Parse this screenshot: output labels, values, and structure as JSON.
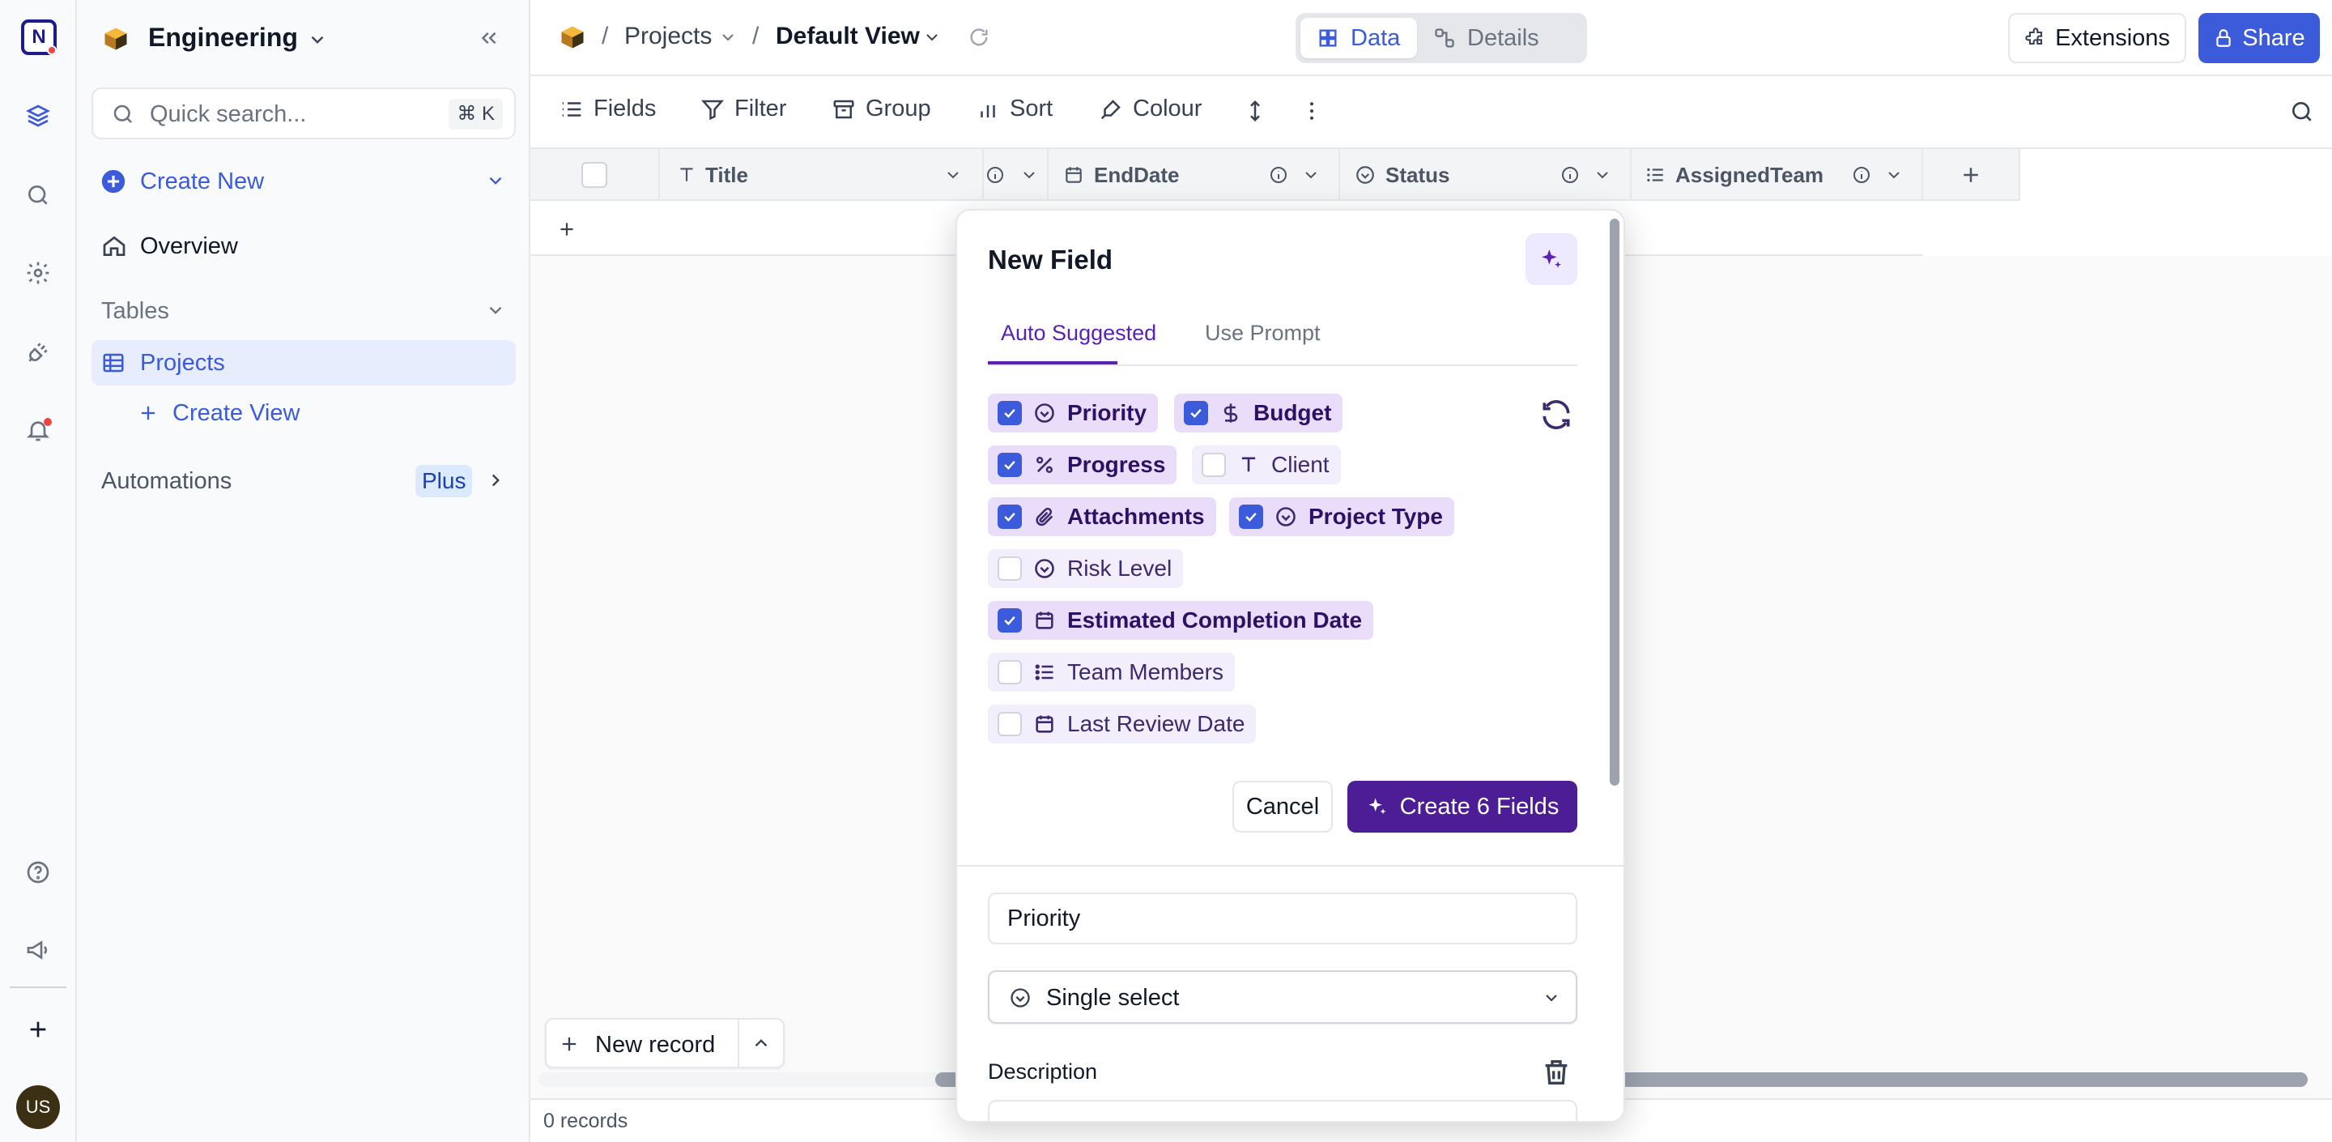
{
  "rail": {
    "logo_letter": "N",
    "avatar_initials": "US",
    "icons": [
      "database-icon",
      "search-icon",
      "settings-icon",
      "plug-icon",
      "bell-icon",
      "help-icon",
      "megaphone-icon",
      "plus-icon"
    ]
  },
  "sidebar": {
    "workspace_name": "Engineering",
    "search_placeholder": "Quick search...",
    "search_shortcut": "⌘ K",
    "create_new": "Create New",
    "overview": "Overview",
    "tables_label": "Tables",
    "table_projects": "Projects",
    "create_view": "Create View",
    "automations": "Automations",
    "automations_badge": "Plus"
  },
  "header": {
    "breadcrumb_table": "Projects",
    "breadcrumb_view": "Default View",
    "tab_data": "Data",
    "tab_details": "Details",
    "extensions": "Extensions",
    "share": "Share"
  },
  "toolbar": {
    "fields": "Fields",
    "filter": "Filter",
    "group": "Group",
    "sort": "Sort",
    "colour": "Colour"
  },
  "grid": {
    "columns": [
      "Title",
      "EndDate",
      "Status",
      "AssignedTeam"
    ],
    "new_record": "New record",
    "records_count": "0 records"
  },
  "modal": {
    "title": "New Field",
    "tab_auto": "Auto Suggested",
    "tab_prompt": "Use Prompt",
    "suggestions": [
      {
        "label": "Priority",
        "icon": "single-select-icon",
        "checked": true
      },
      {
        "label": "Budget",
        "icon": "currency-icon",
        "checked": true
      },
      {
        "label": "Progress",
        "icon": "percent-icon",
        "checked": true
      },
      {
        "label": "Client",
        "icon": "text-icon",
        "checked": false
      },
      {
        "label": "Attachments",
        "icon": "paperclip-icon",
        "checked": true
      },
      {
        "label": "Project Type",
        "icon": "single-select-icon",
        "checked": true
      },
      {
        "label": "Risk Level",
        "icon": "single-select-icon",
        "checked": false
      },
      {
        "label": "Estimated Completion Date",
        "icon": "calendar-icon",
        "checked": true
      },
      {
        "label": "Team Members",
        "icon": "multi-select-icon",
        "checked": false
      },
      {
        "label": "Last Review Date",
        "icon": "calendar-icon",
        "checked": false
      }
    ],
    "cancel": "Cancel",
    "create": "Create 6 Fields",
    "field_name_value": "Priority",
    "field_type": "Single select",
    "description_label": "Description"
  },
  "colors": {
    "accent": "#3b5bdb",
    "purple": "#4c1d95",
    "chip_bg": "#f3eefc"
  }
}
